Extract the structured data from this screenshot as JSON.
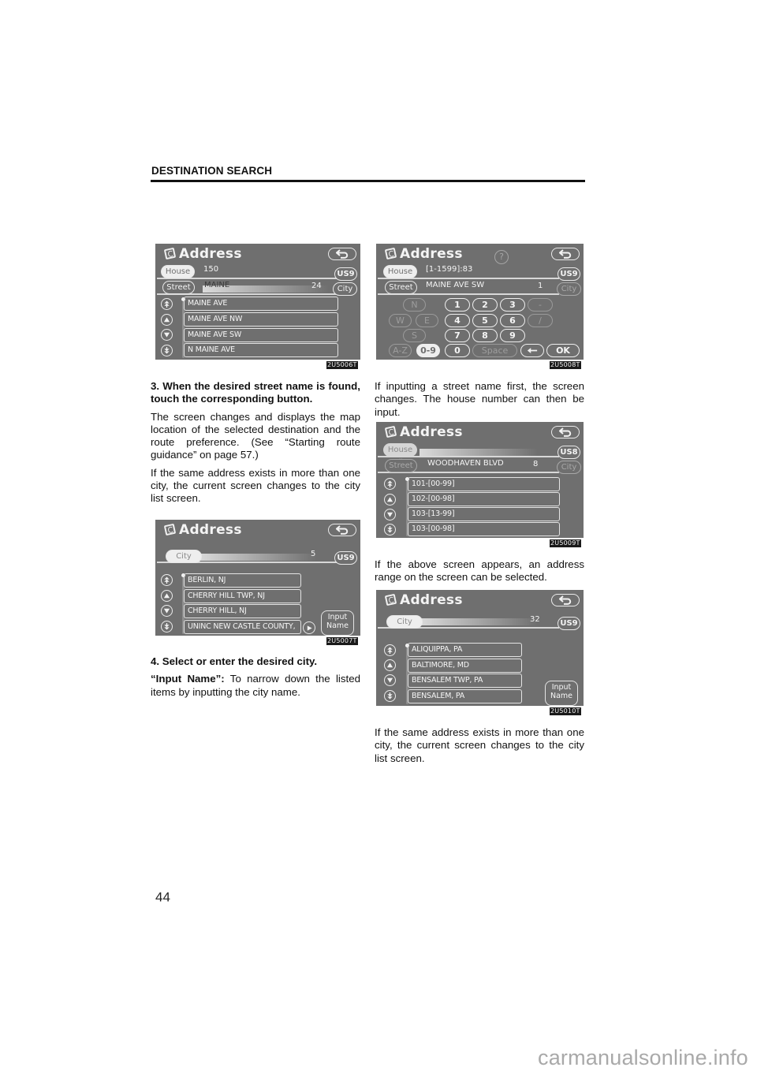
{
  "header": {
    "section_title": "DESTINATION SEARCH"
  },
  "page_number": "44",
  "watermark": "carmanualsonline.info",
  "left_column": {
    "step3": {
      "text": "3. When the desired street name is found, touch the corresponding button."
    },
    "p1": "The screen changes and displays the map location of the selected destination and the route preference.  (See “Starting route guidance” on page 57.)",
    "p2": "If the same address exists in more than one city, the current screen changes to the city list screen.",
    "step4": "4.  Select or enter the desired city.",
    "input_name_term": "“Input Name”:",
    "input_name_desc": " To narrow down the listed items by inputting the city name."
  },
  "right_column": {
    "p1": "If inputting a street name first, the screen changes.  The house number can then be input.",
    "p2": "If the above screen appears, an address range on the screen can be selected.",
    "p3": "If the same address exists in more than one city, the current screen changes to the city list screen."
  },
  "screens": {
    "s1": {
      "code": "2U5006T",
      "title": "Address",
      "house_label": "House #",
      "house_value": "150",
      "street_label": "Street",
      "street_value": "MAINE",
      "street_count": "24",
      "route_label": "US9",
      "city_label": "City",
      "items": [
        "MAINE AVE",
        "MAINE AVE NW",
        "MAINE AVE SW",
        "N MAINE AVE"
      ]
    },
    "s2": {
      "code": "2U5008T",
      "title": "Address",
      "help": "?",
      "house_label": "House #",
      "house_value": "[1-1599]:83",
      "street_label": "Street",
      "street_value": "MAINE AVE SW",
      "street_count": "1",
      "route_label": "US9",
      "city_label": "City",
      "keys": {
        "n": "N",
        "w": "W",
        "e": "E",
        "s": "S",
        "k1": "1",
        "k2": "2",
        "k3": "3",
        "dash": "-",
        "k4": "4",
        "k5": "5",
        "k6": "6",
        "slash": "/",
        "k7": "7",
        "k8": "8",
        "k9": "9",
        "k0": "0",
        "space": "Space",
        "ok": "OK",
        "az": "A-Z",
        "num": "0-9"
      }
    },
    "s3": {
      "code": "2U5007T",
      "title": "Address",
      "city_label": "City",
      "count": "5",
      "route_label": "US9",
      "items": [
        "BERLIN, NJ",
        "CHERRY HILL TWP, NJ",
        "CHERRY HILL, NJ",
        "UNINC NEW CASTLE COUNTY,"
      ],
      "input_name": [
        "Input",
        "Name"
      ]
    },
    "s4": {
      "code": "2U5009T",
      "title": "Address",
      "house_label": "House #",
      "street_label": "Street",
      "street_value": "WOODHAVEN BLVD",
      "street_count": "8",
      "route_label": "US8",
      "city_label": "City",
      "items": [
        "101-[00-99]",
        "102-[00-98]",
        "103-[13-99]",
        "103-[00-98]"
      ]
    },
    "s5": {
      "code": "2U5010T",
      "title": "Address",
      "city_label": "City",
      "count": "32",
      "route_label": "US9",
      "items": [
        "ALIQUIPPA, PA",
        "BALTIMORE, MD",
        "BENSALEM TWP, PA",
        "BENSALEM, PA"
      ],
      "input_name": [
        "Input",
        "Name"
      ]
    }
  }
}
